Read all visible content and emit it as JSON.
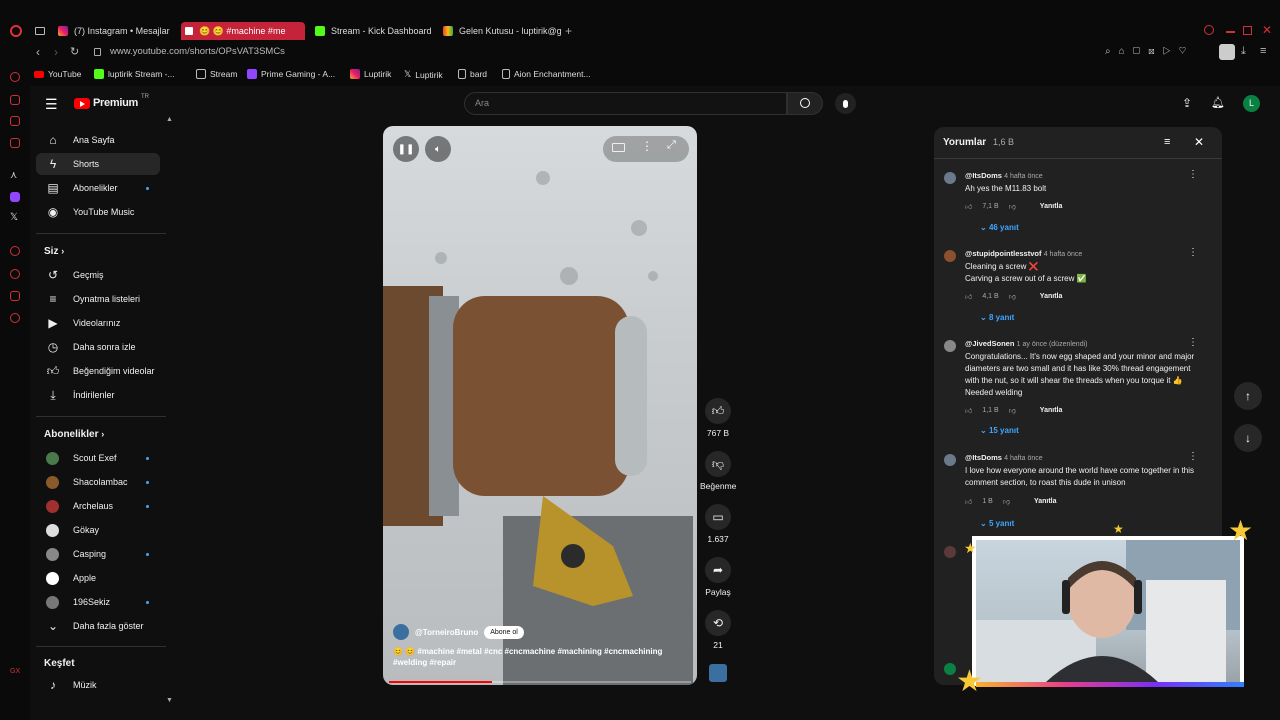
{
  "browser": {
    "tabs": [
      {
        "label": "(7) Instagram • Mesajlar",
        "active": false
      },
      {
        "label": "😊 😊 #machine #me",
        "active": true
      },
      {
        "label": "Stream - Kick Dashboard",
        "active": false
      },
      {
        "label": "Gelen Kutusu - luptirik@g",
        "active": false
      }
    ],
    "url": "www.youtube.com/shorts/OPsVAT3SMCs",
    "bookmarks": [
      "YouTube",
      "luptirik Stream -...",
      "Stream",
      "Prime Gaming - A...",
      "Luptirik",
      "Luptirik",
      "bard",
      "Aion Enchantment..."
    ]
  },
  "header": {
    "logo_text": "Premium",
    "logo_sup": "TR",
    "search_placeholder": "Ara",
    "profile_initial": "L"
  },
  "sidebar": {
    "main": [
      {
        "label": "Ana Sayfa",
        "icon": "home-icon"
      },
      {
        "label": "Shorts",
        "icon": "shorts-icon"
      },
      {
        "label": "Abonelikler",
        "icon": "subscriptions-icon"
      },
      {
        "label": "YouTube Music",
        "icon": "music-icon"
      }
    ],
    "you_title": "Siz",
    "you": [
      {
        "label": "Geçmiş",
        "icon": "history-icon"
      },
      {
        "label": "Oynatma listeleri",
        "icon": "playlist-icon"
      },
      {
        "label": "Videolarınız",
        "icon": "video-icon"
      },
      {
        "label": "Daha sonra izle",
        "icon": "clock-icon"
      },
      {
        "label": "Beğendiğim videolar",
        "icon": "like-icon"
      },
      {
        "label": "İndirilenler",
        "icon": "download-icon"
      }
    ],
    "subs_title": "Abonelikler",
    "subs": [
      {
        "label": "Scout Exef",
        "color": "#4a7a4a"
      },
      {
        "label": "Shacolambac",
        "color": "#8a5a2a"
      },
      {
        "label": "Archelaus",
        "color": "#a03030"
      },
      {
        "label": "Gökay",
        "color": "#dddddd"
      },
      {
        "label": "Casping",
        "color": "#888888"
      },
      {
        "label": "Apple",
        "color": "#ffffff"
      },
      {
        "label": "196Sekiz",
        "color": "#777777"
      }
    ],
    "more": "Daha fazla göster",
    "explore_title": "Keşfet",
    "explore": [
      {
        "label": "Müzik",
        "icon": "music-note-icon"
      }
    ]
  },
  "video": {
    "channel": "@TorneiroBruno",
    "subscribe": "Abone ol",
    "caption": "😊 😊 #machine #metal #cnc #cncmachine #machining #cncmachining #welding #repair",
    "likes": "767 B",
    "dislike": "Beğenme",
    "comments_count": "1.637",
    "share": "Paylaş",
    "remix": "21",
    "progress": 0.34
  },
  "comments_panel": {
    "title": "Yorumlar",
    "count": "1,6 B",
    "reply_label": "Yanıtla",
    "items": [
      {
        "user": "@ItsDoms",
        "time": "4 hafta önce",
        "lines": [
          "Ah yes the M11.83 bolt"
        ],
        "likes": "7,1 B",
        "replies": "46 yanıt"
      },
      {
        "user": "@stupidpointlesstvof",
        "time": "4 hafta önce",
        "lines": [
          "Cleaning a screw ❌",
          "Carving a screw out of a screw ✅"
        ],
        "likes": "4,1 B",
        "replies": "8 yanıt"
      },
      {
        "user": "@JivedSonen",
        "time": "1 ay önce (düzenlendi)",
        "lines": [
          "Congratulations... It's now egg shaped and your minor and major",
          "diameters are two small and it has like 30% thread engagement",
          "with the nut, so it will shear the threads when you torque it 👍",
          "Needed welding"
        ],
        "likes": "1,1 B",
        "replies": "15 yanıt"
      },
      {
        "user": "@ItsDoms",
        "time": "4 hafta önce",
        "lines": [
          "I love how everyone around the world have come together in this",
          "comment section, to roast this dude in unison"
        ],
        "likes": "1 B",
        "replies": "5 yanıt"
      }
    ]
  }
}
